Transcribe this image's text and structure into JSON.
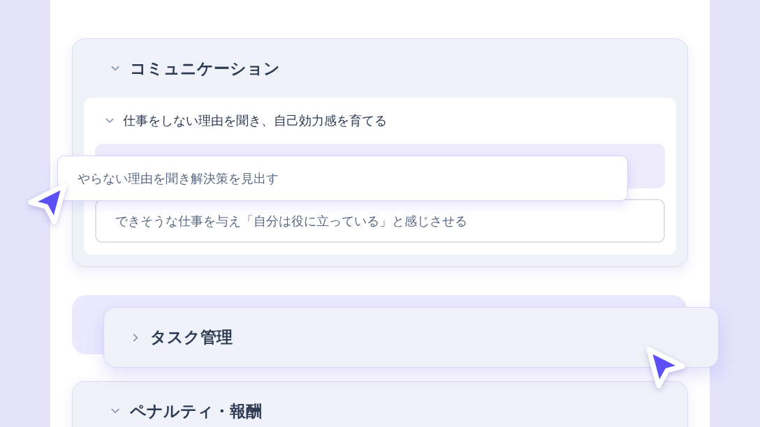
{
  "sections": [
    {
      "kind": "section",
      "title": "コミュニケーション",
      "expanded": true,
      "groups": [
        {
          "title": "仕事をしない理由を聞き、自己効力感を育てる",
          "expanded": true,
          "items": [
            {
              "kind": "placeholder",
              "dragged": {
                "text": "やらない理由を聞き解決策を見出す"
              }
            },
            {
              "kind": "item",
              "text": "できそうな仕事を与え「自分は役に立っている」と感じさせる"
            }
          ]
        }
      ]
    },
    {
      "kind": "placeholder",
      "dragged": {
        "title": "タスク管理",
        "expanded": false
      }
    },
    {
      "kind": "section",
      "title": "ペナルティ・報酬",
      "expanded": true
    }
  ]
}
